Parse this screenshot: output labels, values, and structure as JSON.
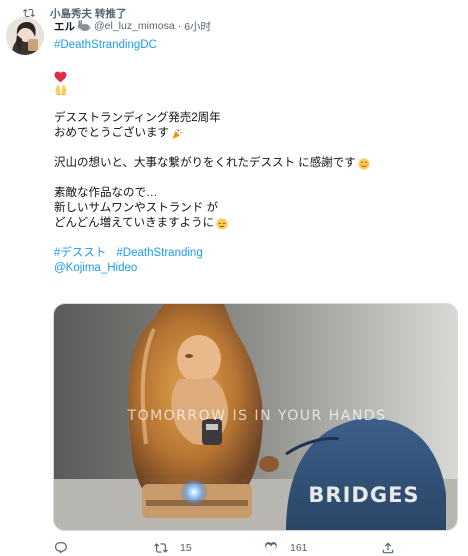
{
  "retweet_banner": {
    "text": "小島秀夫 转推了",
    "icon": "retweet-icon"
  },
  "tweet": {
    "display_name": "エル",
    "name_emoji": "rabbit-emoji",
    "handle": "@el_luz_mimosa",
    "separator": "·",
    "time": "6小时",
    "hashtag_top": "#DeathStrandingDC",
    "emoji_lines": [
      "red-heart-emoji",
      "raising-hands-emoji"
    ],
    "lines": [
      "デスストランディング発売2周年",
      "おめでとうございます",
      "沢山の想いと、大事な繋がりをくれたデススト に感謝です",
      "素敵な作品なので…",
      "新しいサムワンやストランド が",
      "どんどん増えていきますように"
    ],
    "tags": [
      "#デススト",
      "#DeathStranding"
    ],
    "mention": "@Kojima_Hideo"
  },
  "media": {
    "caption": "TOMORROW IS IN YOUR HANDS",
    "cap_text": "BRIDGES",
    "description_icon": "bridge-baby-pod-image"
  },
  "actions": {
    "reply": {
      "icon": "reply-icon",
      "count": ""
    },
    "retweet": {
      "icon": "retweet-icon",
      "count": "15"
    },
    "like": {
      "icon": "heart-icon",
      "count": "161"
    },
    "share": {
      "icon": "share-icon",
      "count": ""
    }
  },
  "colors": {
    "link": "#1d9bf0",
    "muted": "#536471",
    "text": "#0f1419"
  }
}
